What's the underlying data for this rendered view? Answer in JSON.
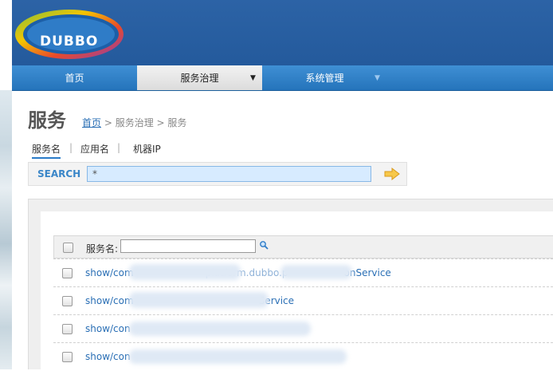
{
  "logo": {
    "text": "DUBBO"
  },
  "nav": {
    "items": [
      {
        "label": "首页"
      },
      {
        "label": "服务治理",
        "arrow": "▼"
      },
      {
        "label": "系统管理",
        "arrow": "▼"
      }
    ]
  },
  "page": {
    "title": "服务",
    "breadcrumb": {
      "home": "首页",
      "rest": " > 服务治理 > 服务"
    }
  },
  "tabs": [
    {
      "label": "服务名"
    },
    {
      "label": "应用名"
    },
    {
      "label": "机器IP"
    }
  ],
  "tab_separator": "|",
  "search": {
    "label": "SEARCH",
    "value": "*"
  },
  "table": {
    "header_label": "服务名:",
    "filter_value": "",
    "rows": [
      {
        "prefix": "show/com",
        "suffix": "platform.dubbo.p",
        "tail": "onService"
      },
      {
        "prefix": "show/com",
        "tail": "Service"
      },
      {
        "prefix": "show/con"
      },
      {
        "prefix": "show/con"
      }
    ]
  },
  "colors": {
    "header_bg": "#2a5fa0",
    "nav_bg": "#2574bb",
    "link": "#2a6fb5",
    "search_label": "#3a86c8"
  }
}
